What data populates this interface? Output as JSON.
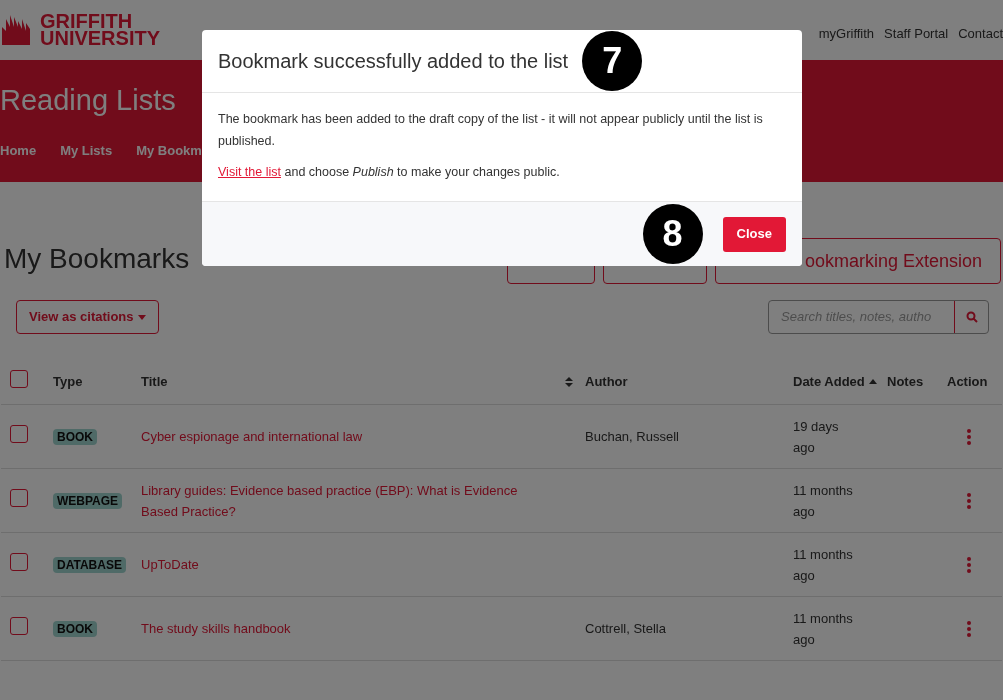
{
  "header": {
    "logo": {
      "line1": "GRIFFITH",
      "line2": "UNIVERSITY"
    },
    "top_links": [
      "myGriffith",
      "Staff Portal",
      "Contact"
    ]
  },
  "banner": {
    "title": "Reading Lists",
    "nav": [
      "Home",
      "My Lists",
      "My Bookm"
    ]
  },
  "page": {
    "title": "My Bookmarks",
    "extension_button": "ookmarking Extension",
    "view_button": "View as citations",
    "search": {
      "placeholder": "Search titles, notes, autho"
    }
  },
  "table": {
    "columns": [
      "Type",
      "Title",
      "Author",
      "Date Added",
      "Notes",
      "Action"
    ],
    "all_checked": false,
    "rows": [
      {
        "checked": false,
        "type": "BOOK",
        "title": "Cyber espionage and international law",
        "author": "Buchan, Russell",
        "date": "19 days ago"
      },
      {
        "checked": false,
        "type": "WEBPAGE",
        "title": "Library guides: Evidence based practice (EBP): What is Evidence Based Practice?",
        "author": "",
        "date": "11 months ago"
      },
      {
        "checked": false,
        "type": "DATABASE",
        "title": "UpToDate",
        "author": "",
        "date": "11 months ago"
      },
      {
        "checked": false,
        "type": "BOOK",
        "title": "The study skills handbook",
        "author": "Cottrell, Stella",
        "date": "11 months ago"
      }
    ]
  },
  "modal": {
    "title": "Bookmark successfully added to the list",
    "marker_title": "7",
    "body": "The bookmark has been added to the draft copy of the list - it will not appear publicly until the list is published.",
    "link": "Visit the list",
    "after_link": "and choose *Publish* to make your changes public.",
    "marker_footer": "8",
    "close": "Close"
  }
}
